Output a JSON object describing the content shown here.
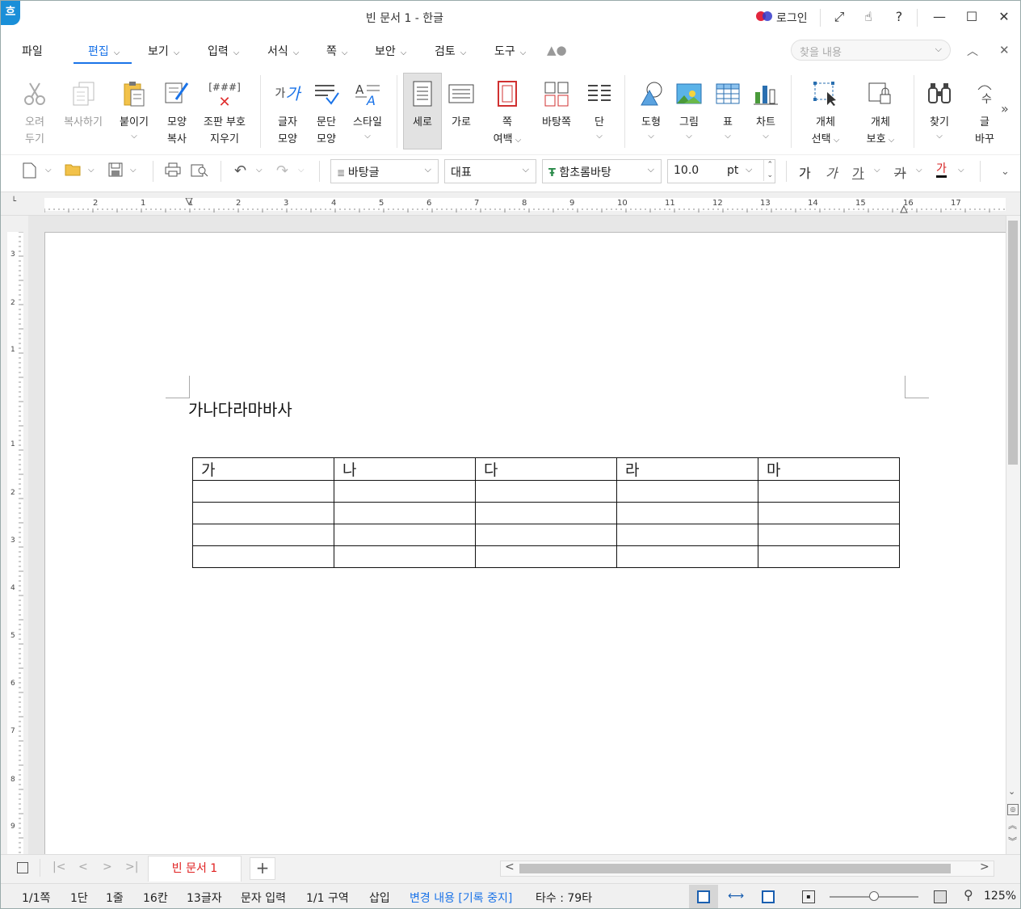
{
  "window": {
    "title": "빈 문서 1 - 한글",
    "logo": "흐",
    "login_label": "로그인",
    "controls": [
      "expand-icon",
      "touch-icon",
      "help-icon",
      "minimize-icon",
      "maximize-icon",
      "close-icon"
    ]
  },
  "menu": {
    "items": [
      "파일",
      "편집",
      "보기",
      "입력",
      "서식",
      "쪽",
      "보안",
      "검토",
      "도구"
    ],
    "active": "편집",
    "search_placeholder": "찾을 내용"
  },
  "ribbon": {
    "cut": {
      "line1": "오려",
      "line2": "두기"
    },
    "copy": "복사하기",
    "paste": "붙이기",
    "format_copy": {
      "line1": "모양",
      "line2": "복사"
    },
    "erase_codes": {
      "line1": "조판 부호",
      "line2": "지우기",
      "icon_text": "[###]"
    },
    "char_shape": {
      "line1": "글자",
      "line2": "모양",
      "icon_text": "가"
    },
    "para_shape": {
      "line1": "문단",
      "line2": "모양"
    },
    "style": "스타일",
    "vertical": "세로",
    "horizontal": "가로",
    "page_margin": {
      "line1": "쪽",
      "line2": "여백"
    },
    "master_page": "바탕쪽",
    "columns": "단",
    "shapes": "도형",
    "picture": "그림",
    "table": "표",
    "chart": "차트",
    "select_object": {
      "line1": "개체",
      "line2": "선택"
    },
    "protect_object": {
      "line1": "개체",
      "line2": "보호"
    },
    "find": "찾기",
    "replace": {
      "line1": "글",
      "line2": "바꾸"
    }
  },
  "toolbar": {
    "style_name": "바탕글",
    "lang": "대표",
    "font": "함초롬바탕",
    "font_size": "10.0",
    "unit": "pt",
    "format_buttons": [
      "가",
      "가",
      "가",
      "가",
      "가"
    ]
  },
  "ruler": {
    "h_ticks": [
      "2",
      "1",
      "1",
      "2",
      "3",
      "4",
      "5",
      "6",
      "7",
      "8",
      "9",
      "10",
      "11",
      "12",
      "13",
      "14",
      "15",
      "16",
      "17"
    ],
    "v_ticks": [
      "3",
      "2",
      "1",
      "1",
      "2",
      "3",
      "4",
      "5",
      "6",
      "7",
      "8",
      "9"
    ]
  },
  "document": {
    "text": "가나다라마바사",
    "table": {
      "header": [
        "가",
        "나",
        "다",
        "라",
        "마"
      ],
      "rows": [
        [
          "",
          "",
          "",
          "",
          ""
        ],
        [
          "",
          "",
          "",
          "",
          ""
        ],
        [
          "",
          "",
          "",
          "",
          ""
        ],
        [
          "",
          "",
          "",
          "",
          ""
        ]
      ]
    }
  },
  "tabs": {
    "doc_tab": "빈 문서 1",
    "add": "+"
  },
  "status": {
    "page": "1/1쪽",
    "column": "1단",
    "line": "1줄",
    "col_pos": "16칸",
    "chars": "13글자",
    "input_mode": "문자 입력",
    "section": "1/1 구역",
    "insert_mode": "삽입",
    "track_changes": "변경 내용 [기록 중지]",
    "typing": "타수 : 79타",
    "zoom": "125%",
    "zoom_level": 0.5,
    "track_color": "#1a73e8"
  }
}
